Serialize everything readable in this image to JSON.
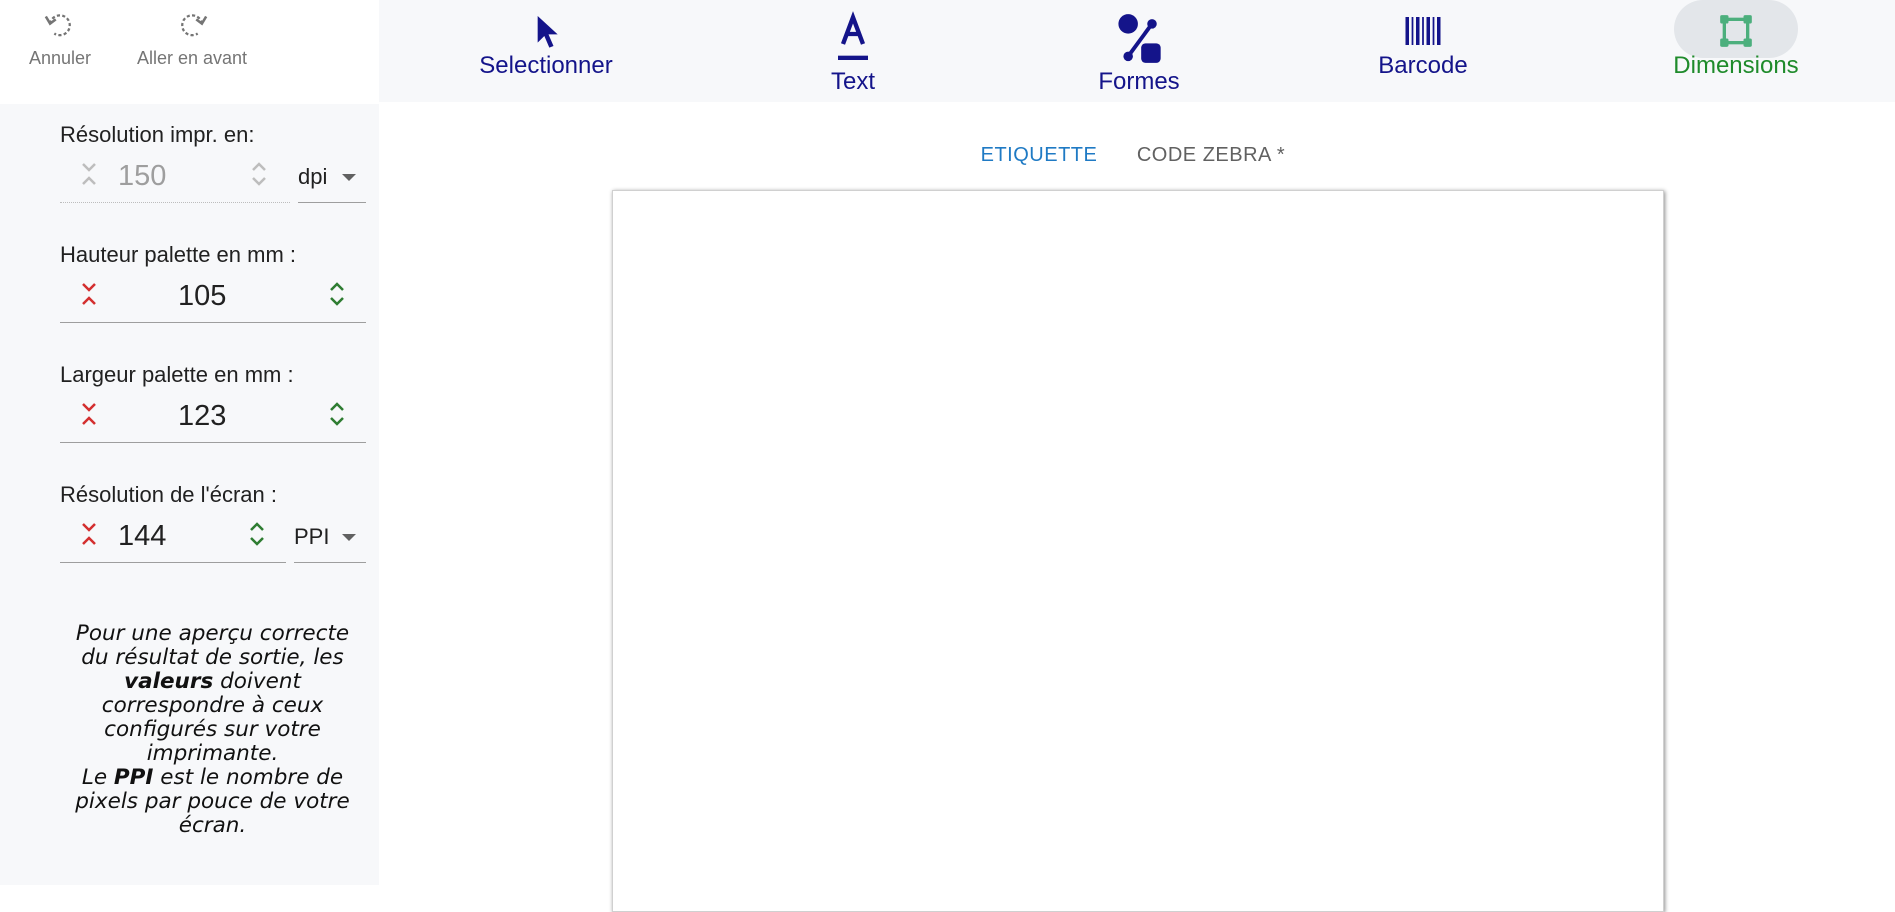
{
  "history": {
    "undo_label": "Annuler",
    "redo_label": "Aller en avant"
  },
  "toolbar": {
    "items": [
      {
        "label": "Selectionner",
        "icon": "cursor-icon",
        "active": false
      },
      {
        "label": "Text",
        "icon": "text-format-icon",
        "active": false
      },
      {
        "label": "Formes",
        "icon": "shapes-icon",
        "active": false
      },
      {
        "label": "Barcode",
        "icon": "barcode-icon",
        "active": false
      },
      {
        "label": "Dimensions",
        "icon": "dimensions-icon",
        "active": true
      }
    ]
  },
  "settings": {
    "print_resolution": {
      "label": "Résolution impr. en:",
      "value": "150",
      "unit": "dpi",
      "disabled": true
    },
    "palette_height": {
      "label": "Hauteur palette en mm :",
      "value": "105"
    },
    "palette_width": {
      "label": "Largeur palette en mm :",
      "value": "123"
    },
    "screen_resolution": {
      "label": "Résolution de l'écran :",
      "value": "144",
      "unit": "PPI"
    }
  },
  "note": {
    "line1_pre": "Pour une aperçu correcte du résultat de sortie, les",
    "line1_bold": "valeurs",
    "line1_post": "doivent correspondre à ceux configurés sur votre imprimante.",
    "line2_pre": "Le",
    "line2_bold": "PPI",
    "line2_post": "est le nombre de pixels par pouce de votre écran."
  },
  "tabs": [
    {
      "label": "ETIQUETTE",
      "active": true
    },
    {
      "label": "CODE ZEBRA *",
      "active": false
    }
  ],
  "colors": {
    "toolbar_text": "#14148a",
    "active_tool": "#1f8b2b",
    "decrement": "#d32f2f",
    "increment": "#2e7d32",
    "tab_active": "#1f7ac4"
  }
}
